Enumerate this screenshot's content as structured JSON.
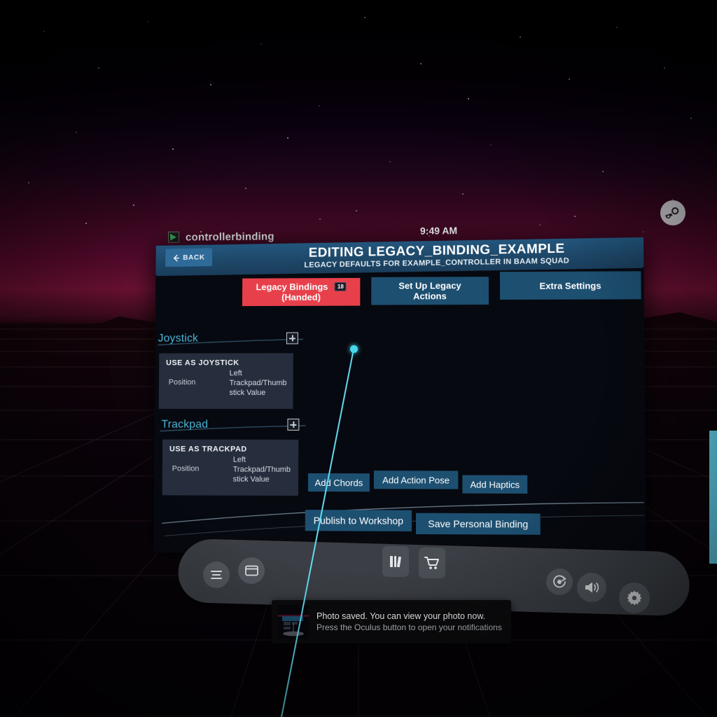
{
  "window": {
    "app_name": "controllerbinding",
    "app_icon": "app-window-icon",
    "clock": "9:49 AM"
  },
  "steam": {
    "icon": "steam-logo-icon"
  },
  "header": {
    "back_label": "BACK",
    "back_icon": "arrow-left-icon",
    "title": "EDITING LEGACY_BINDING_EXAMPLE",
    "subtitle": "LEGACY DEFAULTS FOR EXAMPLE_CONTROLLER IN BAAM SQUAD"
  },
  "tabs": [
    {
      "label": "Legacy Bindings\n(Handed)",
      "line1": "Legacy Bindings",
      "line2": "(Handed)",
      "badge": "18",
      "active": true
    },
    {
      "label": "Set Up Legacy Actions",
      "line1": "Set Up Legacy",
      "line2": "Actions",
      "badge": "",
      "active": false
    },
    {
      "label": "Extra Settings",
      "line1": "Extra Settings",
      "line2": "",
      "badge": "",
      "active": false
    }
  ],
  "sections": [
    {
      "title": "Joystick",
      "add_icon": "add-grid-icon",
      "card": {
        "caption": "USE AS JOYSTICK",
        "key": "Position",
        "value": "Left Trackpad/Thumb stick Value",
        "value_lines": [
          "Left",
          "Trackpad/Thumb",
          "stick Value"
        ]
      }
    },
    {
      "title": "Trackpad",
      "add_icon": "add-grid-icon",
      "card": {
        "caption": "USE AS TRACKPAD",
        "key": "Position",
        "value": "Left Trackpad/Thumb stick Value",
        "value_lines": [
          "Left",
          "Trackpad/Thumb",
          "stick Value"
        ]
      }
    }
  ],
  "action_buttons": [
    {
      "label": "Add Chords"
    },
    {
      "label": "Add Action Pose"
    },
    {
      "label": "Add Haptics"
    }
  ],
  "footer_buttons": [
    {
      "label": "Publish to Workshop"
    },
    {
      "label": "Save Personal Binding"
    }
  ],
  "dock": {
    "items": [
      {
        "name": "menu-icon",
        "glyph": "menu"
      },
      {
        "name": "window-icon",
        "glyph": "window"
      },
      {
        "name": "library-icon",
        "glyph": "library"
      },
      {
        "name": "store-cart-icon",
        "glyph": "cart"
      },
      {
        "name": "record-icon",
        "glyph": "record"
      },
      {
        "name": "volume-icon",
        "glyph": "volume"
      },
      {
        "name": "settings-gear-icon",
        "glyph": "gear"
      }
    ]
  },
  "toast": {
    "thumbnail": "screenshot-thumbnail",
    "line1": "Photo saved. You can view your photo now.",
    "line2": "Press the Oculus button to open your notifications"
  },
  "pointer": {
    "cursor": "laser-cursor-dot"
  },
  "colors": {
    "accent_red": "#e8404b",
    "tab_blue": "#1d4f70",
    "header_blue": "#1d4666",
    "section_cyan": "#4ab7d8",
    "laser_cyan": "#49d7ef",
    "panel_bg": "#070910",
    "card_bg": "#262d3c"
  }
}
